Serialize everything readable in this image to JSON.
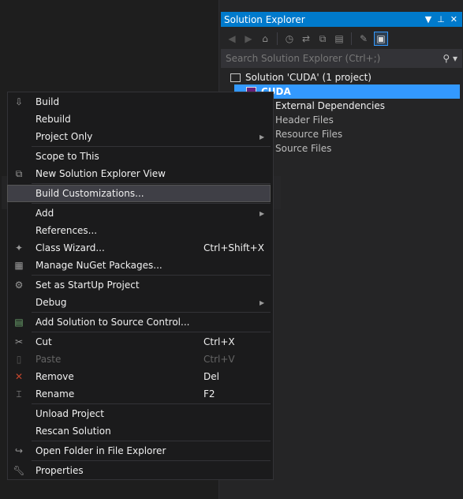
{
  "solution_explorer": {
    "title": "Solution Explorer",
    "search_placeholder": "Search Solution Explorer (Ctrl+;)",
    "tree": [
      {
        "label": "Solution 'CUDA' (1 project)"
      },
      {
        "label": "CUDA"
      },
      {
        "label": "External Dependencies"
      },
      {
        "label": "Header Files"
      },
      {
        "label": "Resource Files"
      },
      {
        "label": "Source Files"
      }
    ]
  },
  "menu": {
    "items": [
      {
        "label": "Build",
        "icon": "build-icon"
      },
      {
        "label": "Rebuild"
      },
      {
        "label": "Project Only",
        "submenu": true
      },
      {
        "label": "Scope to This"
      },
      {
        "label": "New Solution Explorer View",
        "icon": "new-view-icon"
      },
      {
        "label": "Build Customizations..."
      },
      {
        "label": "Add",
        "submenu": true
      },
      {
        "label": "References..."
      },
      {
        "label": "Class Wizard...",
        "shortcut": "Ctrl+Shift+X",
        "icon": "class-wizard-icon"
      },
      {
        "label": "Manage NuGet Packages...",
        "icon": "nuget-icon"
      },
      {
        "label": "Set as StartUp Project",
        "icon": "gear-icon"
      },
      {
        "label": "Debug",
        "submenu": true
      },
      {
        "label": "Add Solution to Source Control...",
        "icon": "source-control-icon"
      },
      {
        "label": "Cut",
        "shortcut": "Ctrl+X",
        "icon": "scissors-icon"
      },
      {
        "label": "Paste",
        "shortcut": "Ctrl+V",
        "icon": "paste-icon",
        "disabled": true
      },
      {
        "label": "Remove",
        "shortcut": "Del",
        "icon": "remove-x-icon"
      },
      {
        "label": "Rename",
        "shortcut": "F2",
        "icon": "rename-icon"
      },
      {
        "label": "Unload Project"
      },
      {
        "label": "Rescan Solution"
      },
      {
        "label": "Open Folder in File Explorer",
        "icon": "open-folder-arrow-icon"
      },
      {
        "label": "Properties",
        "icon": "wrench-icon"
      }
    ]
  },
  "colors": {
    "accent": "#007acc",
    "selection": "#3399ff",
    "background": "#1e1e1e",
    "menu_background": "#1b1b1c",
    "remove_icon": "#c5462d"
  }
}
